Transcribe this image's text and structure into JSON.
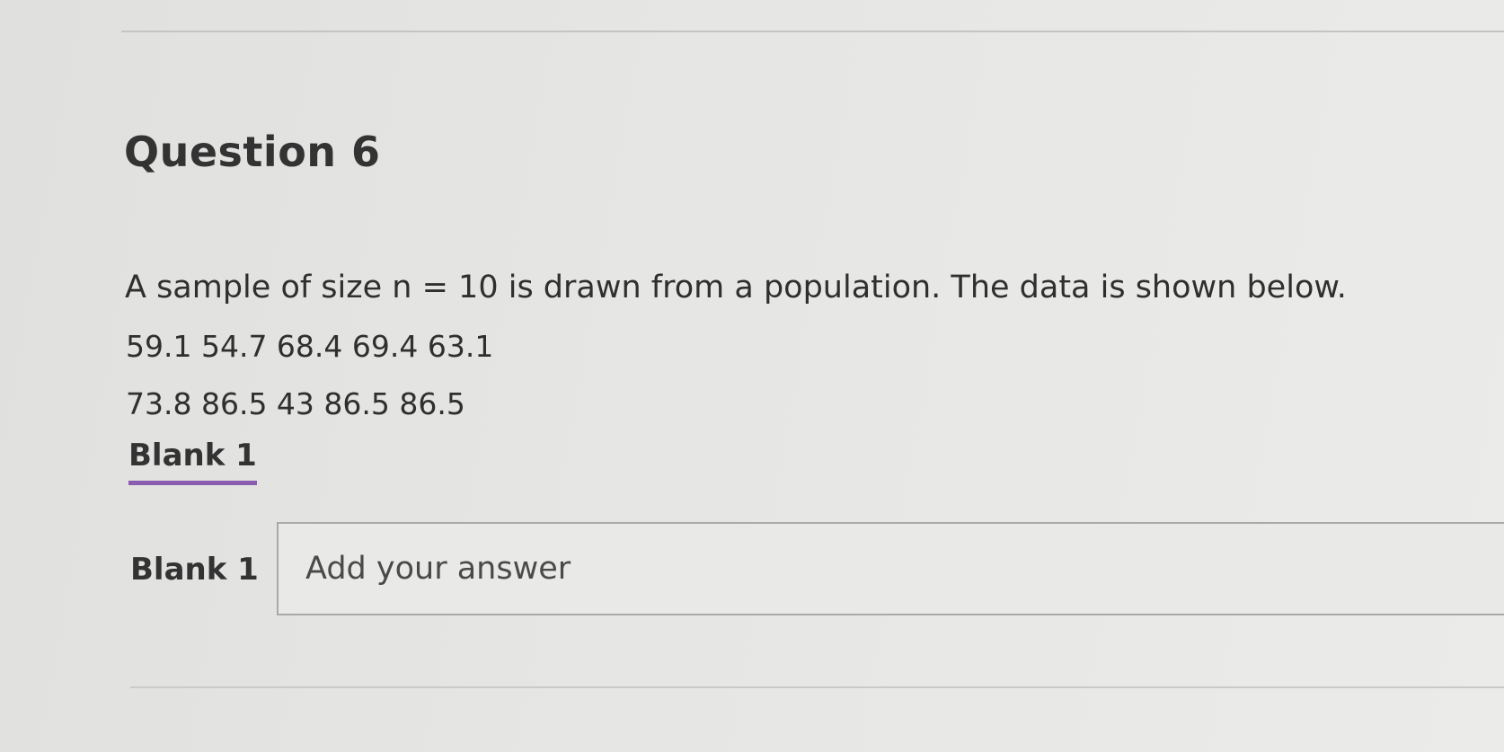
{
  "question": {
    "title": "Question 6",
    "prompt": "A sample of size n = 10 is drawn from a population. The data is shown below.",
    "data_lines": [
      "59.1 54.7 68.4 69.4 63.1",
      "73.8 86.5 43 86.5 86.5"
    ]
  },
  "blank": {
    "heading": "Blank 1",
    "label": "Blank 1",
    "input": {
      "placeholder": "Add your answer",
      "value": ""
    }
  },
  "colors": {
    "accent_underline": "#8a5cb0",
    "text": "#2f2f2f",
    "background": "#e3e3e1"
  }
}
